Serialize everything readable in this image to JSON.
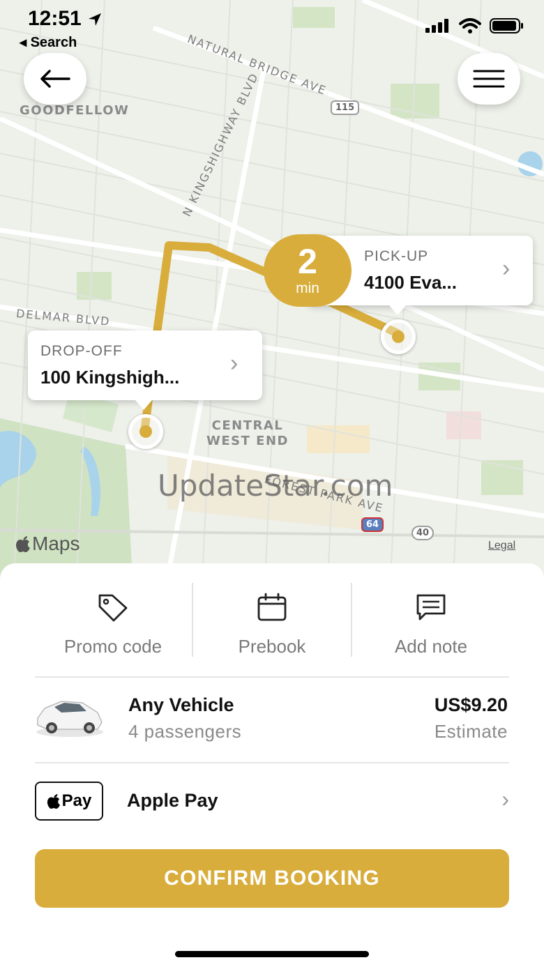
{
  "status_bar": {
    "time": "12:51",
    "back_label": "◂ Search"
  },
  "map": {
    "road_labels": [
      "NATURAL BRIDGE AVE",
      "N KINGSHIGHWAY BLVD",
      "DELMAR BLVD",
      "FOREST PARK AVE"
    ],
    "area_labels": [
      "GOODFELLOW",
      "CENTRAL",
      "WEST END"
    ],
    "shields": [
      "115",
      "64",
      "40"
    ],
    "attribution": "Maps",
    "legal": "Legal",
    "watermark": "UpdateStar.com",
    "route_color": "#d8ad3c"
  },
  "pickup": {
    "label": "PICK-UP",
    "address": "4100 Eva...",
    "eta_value": "2",
    "eta_unit": "min"
  },
  "dropoff": {
    "label": "DROP-OFF",
    "address": "100 Kingshigh..."
  },
  "actions": [
    {
      "label": "Promo code",
      "icon": "tag-icon"
    },
    {
      "label": "Prebook",
      "icon": "calendar-icon"
    },
    {
      "label": "Add note",
      "icon": "note-icon"
    }
  ],
  "vehicle": {
    "name": "Any Vehicle",
    "passengers": "4 passengers",
    "price": "US$9.20",
    "price_note": "Estimate"
  },
  "payment": {
    "badge": "Pay",
    "name": "Apple Pay"
  },
  "confirm_label": "CONFIRM BOOKING",
  "colors": {
    "accent": "#d8ad3c",
    "map_bg": "#eef0ea",
    "park": "#cfe2c2",
    "water": "#a9d3ea"
  }
}
